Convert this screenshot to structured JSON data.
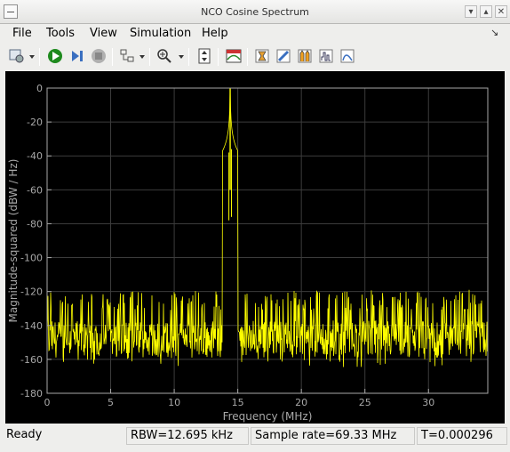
{
  "window": {
    "title": "NCO Cosine Spectrum"
  },
  "menu": {
    "file": "File",
    "tools": "Tools",
    "view": "View",
    "simulation": "Simulation",
    "help": "Help"
  },
  "toolbar": {
    "icons": [
      "settings-icon",
      "run-icon",
      "step-forward-icon",
      "stop-icon",
      "highlight-icon",
      "zoom-in-icon",
      "scale-axes-icon",
      "spectrum-settings-icon",
      "trace-selection-icon",
      "measure-icon",
      "peak-finder-icon",
      "channel-measurements-icon",
      "distortion-measurements-icon"
    ]
  },
  "colors": {
    "trace": "#ffff00",
    "background": "#000000",
    "axes": "#a8a8a8",
    "grid": "#3c3c3c"
  },
  "chart_data": {
    "type": "line",
    "title": "",
    "xlabel": "Frequency (MHz)",
    "ylabel": "Magnitude-squared (dBW / Hz)",
    "xlim": [
      0,
      34.665
    ],
    "ylim": [
      -180,
      0
    ],
    "xticks": [
      0,
      5,
      10,
      15,
      20,
      25,
      30
    ],
    "yticks": [
      0,
      -20,
      -40,
      -60,
      -80,
      -100,
      -120,
      -140,
      -160,
      -180
    ],
    "xtick_labels": [
      "0",
      "5",
      "10",
      "15",
      "20",
      "25",
      "30"
    ],
    "ytick_labels": [
      "0",
      "-20",
      "-40",
      "-60",
      "-80",
      "-100",
      "-120",
      "-140",
      "-160",
      "-180"
    ],
    "grid": true,
    "series": [
      {
        "peak": {
          "x": 14.4,
          "y": 0
        },
        "noise_floor_range": [
          -165,
          -118
        ],
        "sidelobe_points": [
          {
            "x": 14.5,
            "y": -36
          },
          {
            "x": 14.3,
            "y": -38
          }
        ]
      }
    ]
  },
  "status": {
    "state": "Ready",
    "rbw": "RBW=12.695 kHz",
    "sample_rate": "Sample rate=69.33 MHz",
    "time": "T=0.000296"
  }
}
